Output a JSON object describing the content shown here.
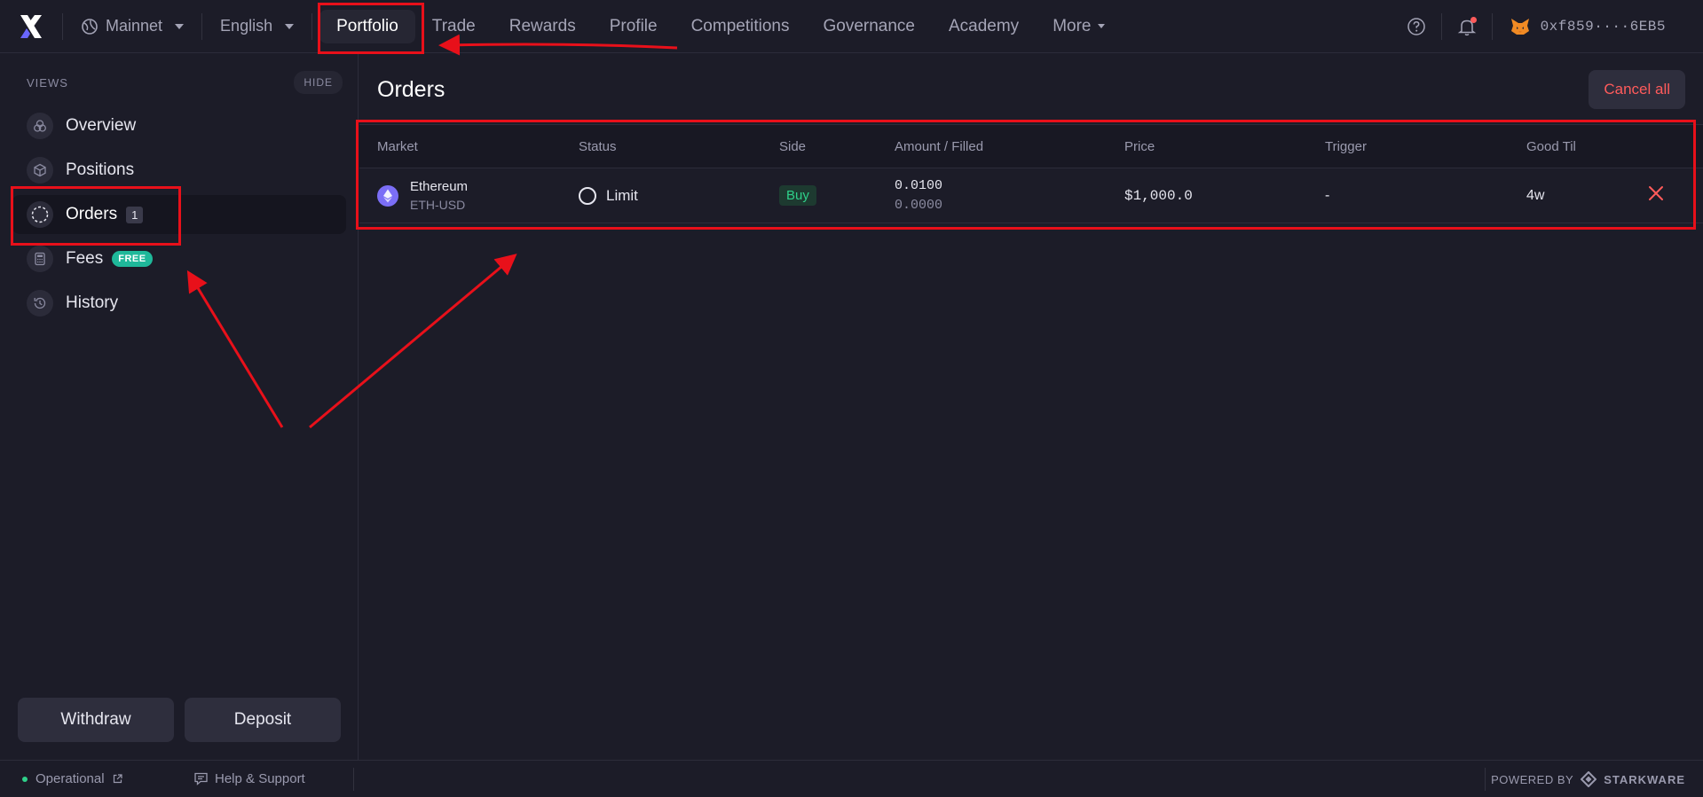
{
  "topbar": {
    "network": "Mainnet",
    "language": "English",
    "nav": [
      "Portfolio",
      "Trade",
      "Rewards",
      "Profile",
      "Competitions",
      "Governance",
      "Academy"
    ],
    "more_label": "More",
    "wallet_address": "0xf859····6EB5"
  },
  "sidebar": {
    "views_label": "VIEWS",
    "hide_label": "HIDE",
    "items": [
      {
        "label": "Overview",
        "icon": "overview-icon"
      },
      {
        "label": "Positions",
        "icon": "cube-icon"
      },
      {
        "label": "Orders",
        "icon": "dashed-circle-icon",
        "badge": "1"
      },
      {
        "label": "Fees",
        "icon": "calculator-icon",
        "badge": "FREE"
      },
      {
        "label": "History",
        "icon": "clock-history-icon"
      }
    ],
    "withdraw_label": "Withdraw",
    "deposit_label": "Deposit"
  },
  "main": {
    "title": "Orders",
    "cancel_all_label": "Cancel all",
    "columns": [
      "Market",
      "Status",
      "Side",
      "Amount / Filled",
      "Price",
      "Trigger",
      "Good Til"
    ],
    "orders": [
      {
        "market_name": "Ethereum",
        "market_symbol": "ETH-USD",
        "status": "Limit",
        "side": "Buy",
        "amount": "0.0100",
        "filled": "0.0000",
        "price": "$1,000.0",
        "trigger": "-",
        "good_til": "4w"
      }
    ]
  },
  "footer": {
    "status": "Operational",
    "help": "Help & Support",
    "powered_by": "POWERED BY",
    "brand": "STARKWARE"
  },
  "colors": {
    "background": "#1c1c28",
    "accent_red": "#ff5b5b",
    "buy_green": "#2fd08a",
    "free_badge": "#1fb89a",
    "annotation_red": "#e8101a",
    "eth_purple": "#7b6ef6"
  }
}
